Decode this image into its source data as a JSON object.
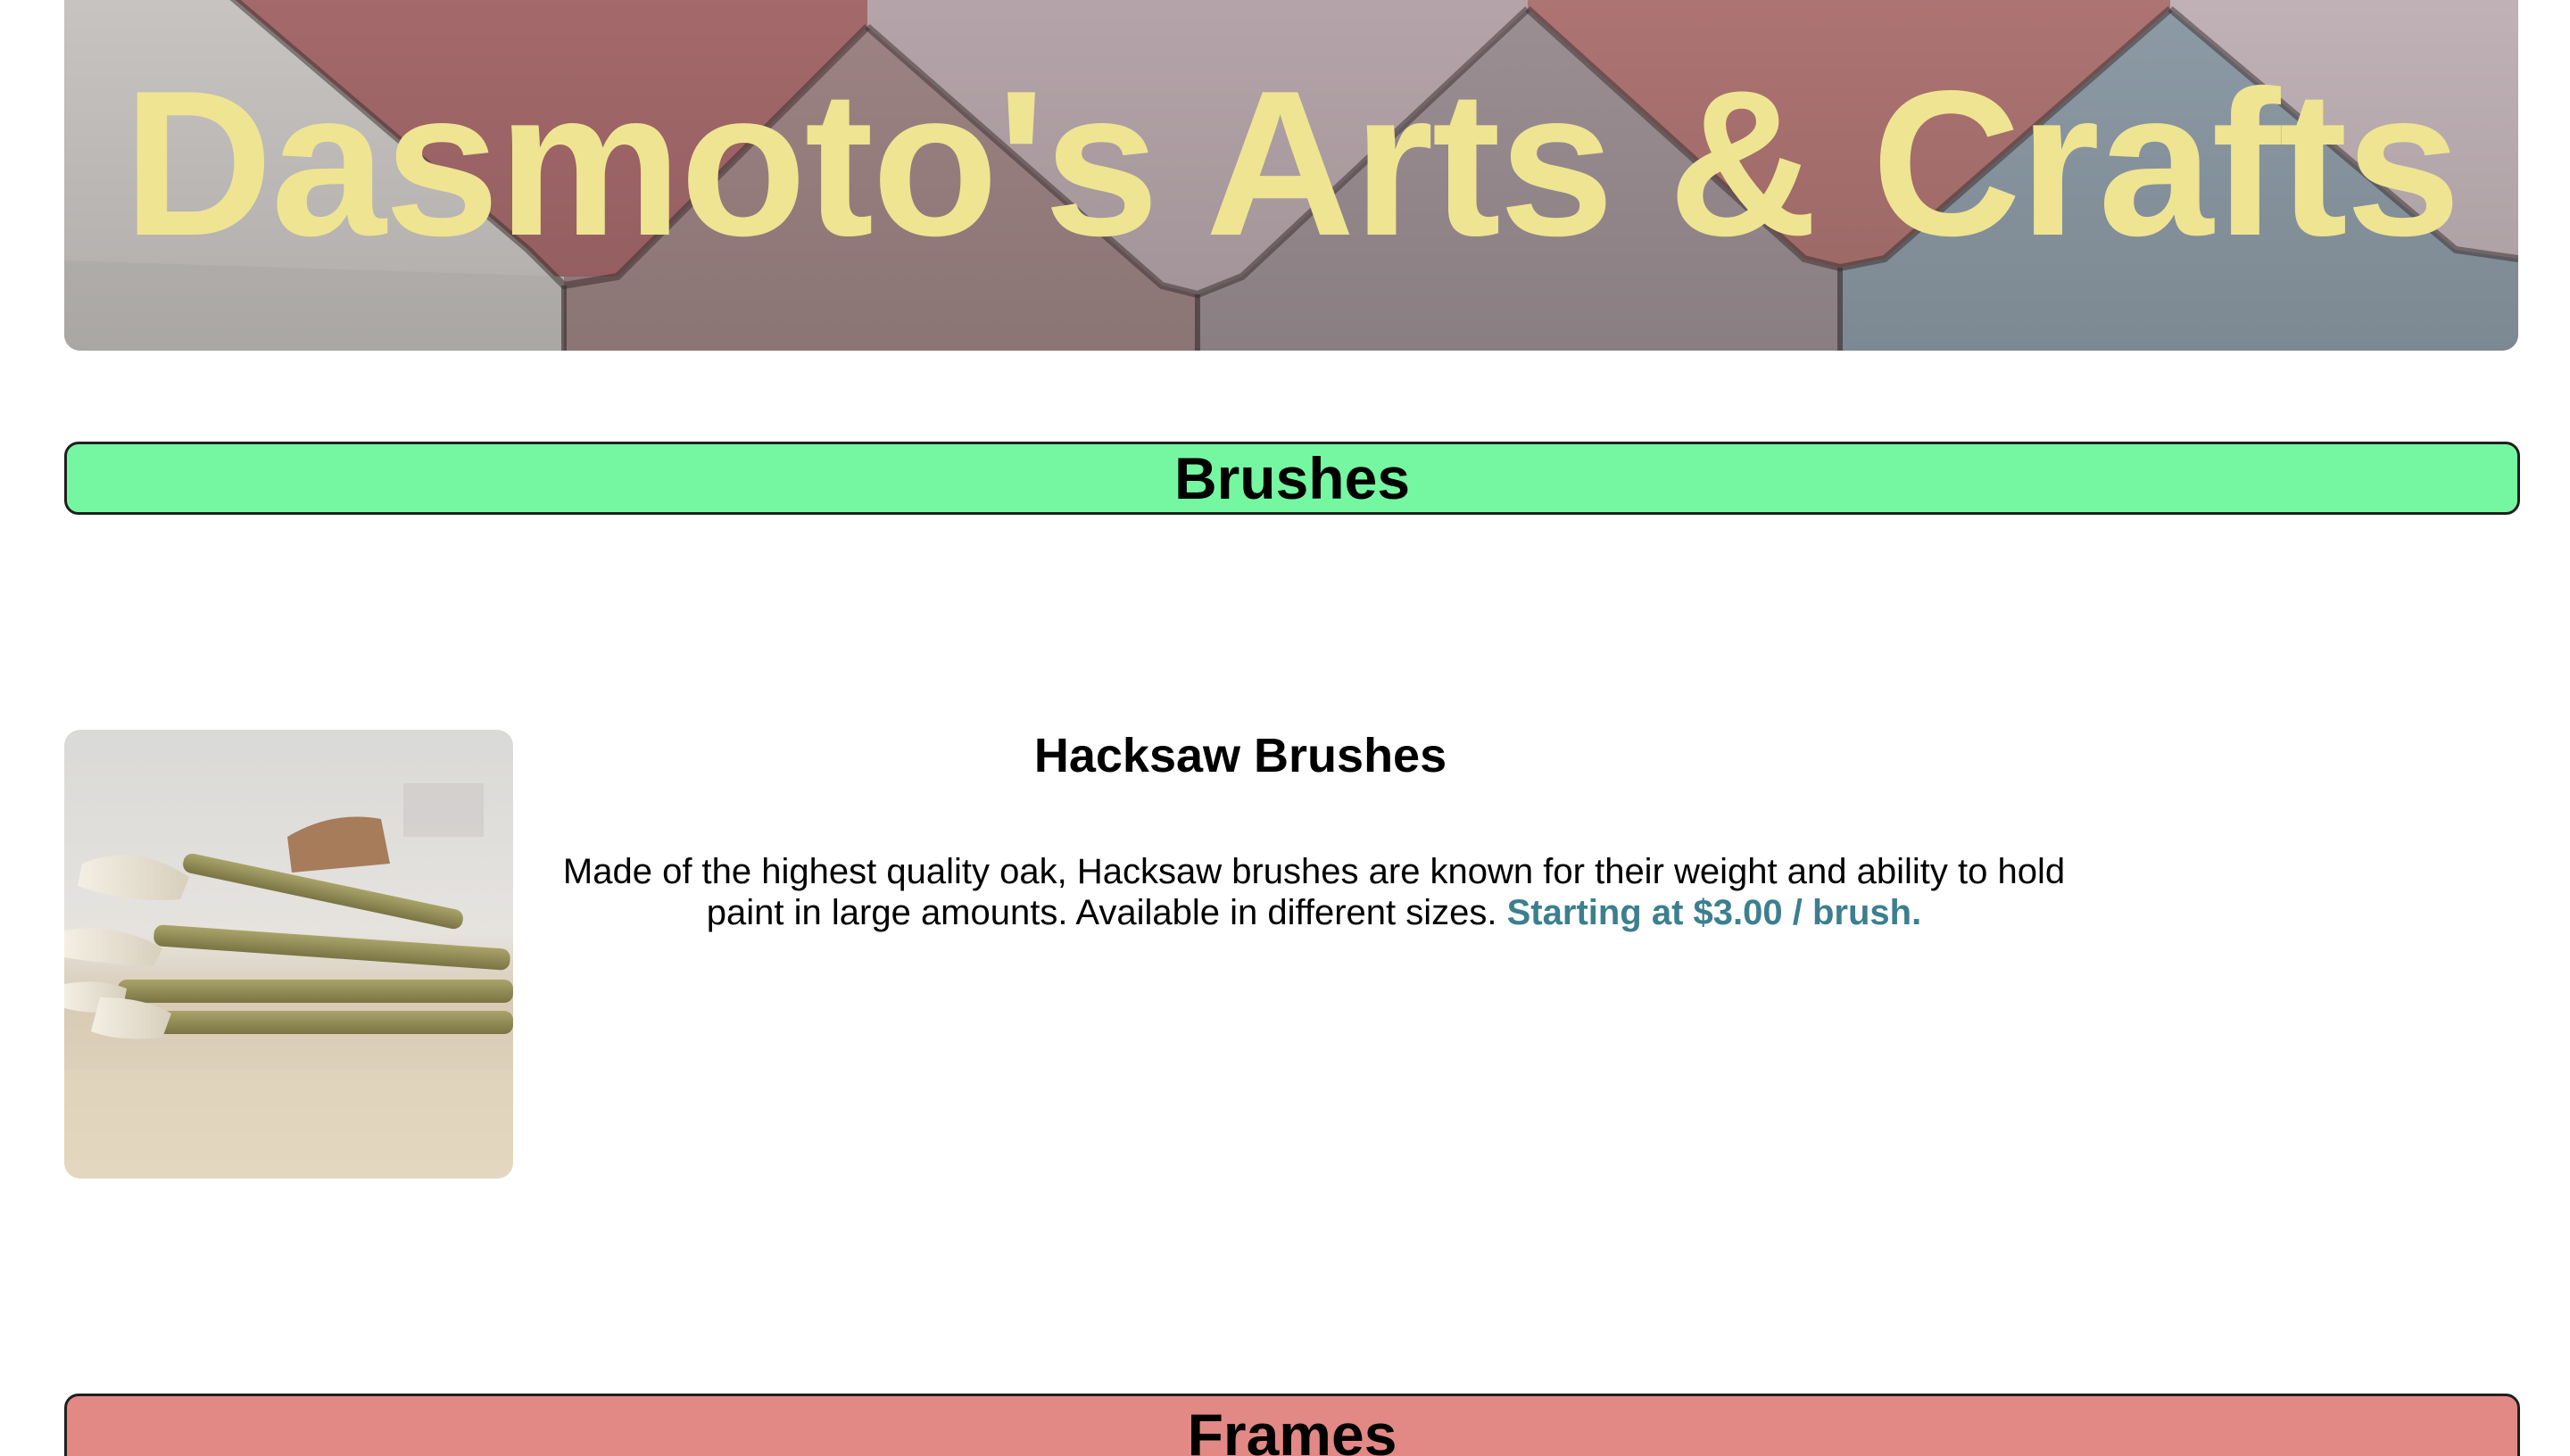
{
  "header": {
    "title": "Dasmoto's Arts & Crafts"
  },
  "sections": [
    {
      "title": "Brushes",
      "color": "#75f7a2",
      "product": {
        "image": "paint-brushes-photo",
        "name": "Hacksaw Brushes",
        "description": "Made of the highest quality oak, Hacksaw brushes are known for their weight and ability to hold paint in large amounts. Available in different sizes.",
        "price": "Starting at $3.00 / brush."
      }
    },
    {
      "title": "Frames",
      "color": "#e28985"
    }
  ],
  "colors": {
    "title_text": "#efe492",
    "price_text": "#3c7f8f"
  }
}
